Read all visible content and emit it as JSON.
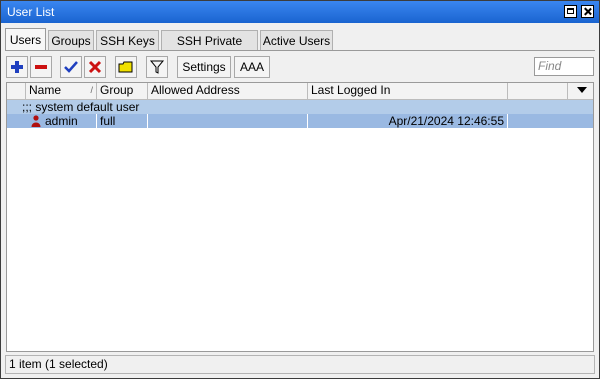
{
  "window": {
    "title": "User List"
  },
  "tabs": [
    {
      "label": "Users",
      "active": true
    },
    {
      "label": "Groups",
      "active": false
    },
    {
      "label": "SSH Keys",
      "active": false
    },
    {
      "label": "SSH Private Keys",
      "active": false
    },
    {
      "label": "Active Users",
      "active": false
    }
  ],
  "toolbar": {
    "settings_label": "Settings",
    "aaa_label": "AAA",
    "find_placeholder": "Find"
  },
  "table": {
    "columns": [
      "Name",
      "Group",
      "Allowed Address",
      "Last Logged In"
    ],
    "sort_indicator": "/",
    "comment": ";;; system default user",
    "rows": [
      {
        "name": "admin",
        "group": "full",
        "allowed_address": "",
        "last_logged_in": "Apr/21/2024 12:46:55",
        "selected": true
      }
    ]
  },
  "status": {
    "text": "1 item (1 selected)"
  },
  "colors": {
    "titlebar": "#1a64d0",
    "selected_row": "#9ab9e2",
    "comment_row": "#b3cce9",
    "add": "#1f3fbf",
    "remove": "#cc1111",
    "enable": "#1f3fbf",
    "disable": "#cc1111",
    "comment_icon": "#f0e000",
    "user_icon": "#b01010"
  }
}
